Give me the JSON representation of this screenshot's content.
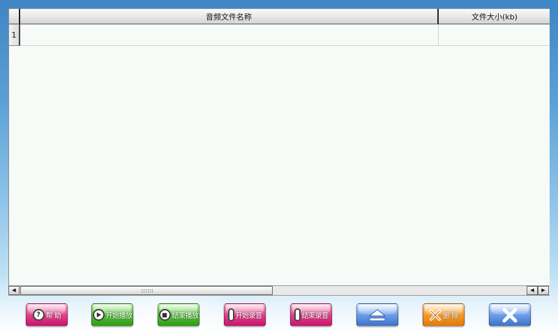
{
  "table": {
    "headers": [
      "音频文件名称",
      "文件大小(kb)"
    ],
    "rows": [
      {
        "index": "1",
        "file_name": "",
        "file_size": ""
      }
    ]
  },
  "buttons": {
    "help": {
      "label": "帮 助",
      "icon": "question-icon"
    },
    "start_play": {
      "label": "开始播放",
      "icon": "play-icon"
    },
    "stop_play": {
      "label": "结束播放",
      "icon": "stop-icon"
    },
    "start_record": {
      "label": "开始录音",
      "icon": "mic-icon"
    },
    "stop_record": {
      "label": "结束录音",
      "icon": "mic-icon"
    },
    "eject": {
      "label": "",
      "icon": "eject-icon"
    },
    "delete": {
      "label": "删 除",
      "icon": "delete-x-icon"
    },
    "close": {
      "label": "",
      "icon": "close-icon"
    }
  },
  "colors": {
    "pink": "#e2458c",
    "green": "#55c23a",
    "blue": "#6c9fe8",
    "orange": "#f59a2a",
    "grid_bg": "#f6fbf8"
  }
}
